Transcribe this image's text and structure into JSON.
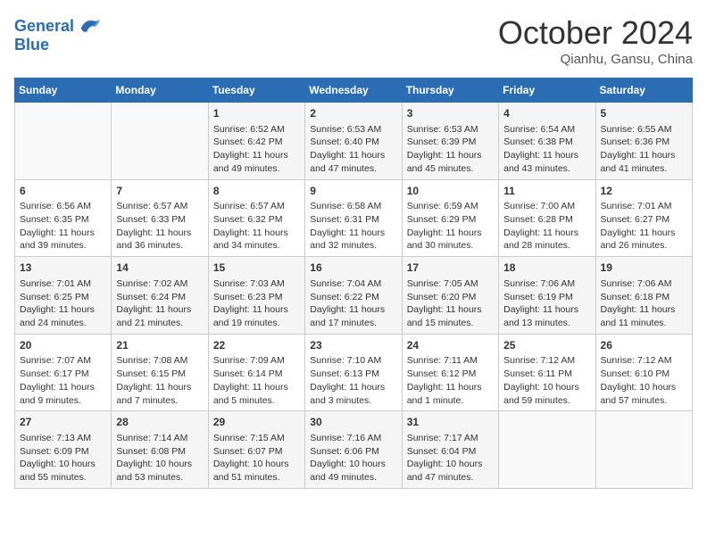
{
  "header": {
    "logo_line1": "General",
    "logo_line2": "Blue",
    "month": "October 2024",
    "location": "Qianhu, Gansu, China"
  },
  "weekdays": [
    "Sunday",
    "Monday",
    "Tuesday",
    "Wednesday",
    "Thursday",
    "Friday",
    "Saturday"
  ],
  "weeks": [
    [
      {
        "day": "",
        "sunrise": "",
        "sunset": "",
        "daylight": ""
      },
      {
        "day": "",
        "sunrise": "",
        "sunset": "",
        "daylight": ""
      },
      {
        "day": "1",
        "sunrise": "Sunrise: 6:52 AM",
        "sunset": "Sunset: 6:42 PM",
        "daylight": "Daylight: 11 hours and 49 minutes."
      },
      {
        "day": "2",
        "sunrise": "Sunrise: 6:53 AM",
        "sunset": "Sunset: 6:40 PM",
        "daylight": "Daylight: 11 hours and 47 minutes."
      },
      {
        "day": "3",
        "sunrise": "Sunrise: 6:53 AM",
        "sunset": "Sunset: 6:39 PM",
        "daylight": "Daylight: 11 hours and 45 minutes."
      },
      {
        "day": "4",
        "sunrise": "Sunrise: 6:54 AM",
        "sunset": "Sunset: 6:38 PM",
        "daylight": "Daylight: 11 hours and 43 minutes."
      },
      {
        "day": "5",
        "sunrise": "Sunrise: 6:55 AM",
        "sunset": "Sunset: 6:36 PM",
        "daylight": "Daylight: 11 hours and 41 minutes."
      }
    ],
    [
      {
        "day": "6",
        "sunrise": "Sunrise: 6:56 AM",
        "sunset": "Sunset: 6:35 PM",
        "daylight": "Daylight: 11 hours and 39 minutes."
      },
      {
        "day": "7",
        "sunrise": "Sunrise: 6:57 AM",
        "sunset": "Sunset: 6:33 PM",
        "daylight": "Daylight: 11 hours and 36 minutes."
      },
      {
        "day": "8",
        "sunrise": "Sunrise: 6:57 AM",
        "sunset": "Sunset: 6:32 PM",
        "daylight": "Daylight: 11 hours and 34 minutes."
      },
      {
        "day": "9",
        "sunrise": "Sunrise: 6:58 AM",
        "sunset": "Sunset: 6:31 PM",
        "daylight": "Daylight: 11 hours and 32 minutes."
      },
      {
        "day": "10",
        "sunrise": "Sunrise: 6:59 AM",
        "sunset": "Sunset: 6:29 PM",
        "daylight": "Daylight: 11 hours and 30 minutes."
      },
      {
        "day": "11",
        "sunrise": "Sunrise: 7:00 AM",
        "sunset": "Sunset: 6:28 PM",
        "daylight": "Daylight: 11 hours and 28 minutes."
      },
      {
        "day": "12",
        "sunrise": "Sunrise: 7:01 AM",
        "sunset": "Sunset: 6:27 PM",
        "daylight": "Daylight: 11 hours and 26 minutes."
      }
    ],
    [
      {
        "day": "13",
        "sunrise": "Sunrise: 7:01 AM",
        "sunset": "Sunset: 6:25 PM",
        "daylight": "Daylight: 11 hours and 24 minutes."
      },
      {
        "day": "14",
        "sunrise": "Sunrise: 7:02 AM",
        "sunset": "Sunset: 6:24 PM",
        "daylight": "Daylight: 11 hours and 21 minutes."
      },
      {
        "day": "15",
        "sunrise": "Sunrise: 7:03 AM",
        "sunset": "Sunset: 6:23 PM",
        "daylight": "Daylight: 11 hours and 19 minutes."
      },
      {
        "day": "16",
        "sunrise": "Sunrise: 7:04 AM",
        "sunset": "Sunset: 6:22 PM",
        "daylight": "Daylight: 11 hours and 17 minutes."
      },
      {
        "day": "17",
        "sunrise": "Sunrise: 7:05 AM",
        "sunset": "Sunset: 6:20 PM",
        "daylight": "Daylight: 11 hours and 15 minutes."
      },
      {
        "day": "18",
        "sunrise": "Sunrise: 7:06 AM",
        "sunset": "Sunset: 6:19 PM",
        "daylight": "Daylight: 11 hours and 13 minutes."
      },
      {
        "day": "19",
        "sunrise": "Sunrise: 7:06 AM",
        "sunset": "Sunset: 6:18 PM",
        "daylight": "Daylight: 11 hours and 11 minutes."
      }
    ],
    [
      {
        "day": "20",
        "sunrise": "Sunrise: 7:07 AM",
        "sunset": "Sunset: 6:17 PM",
        "daylight": "Daylight: 11 hours and 9 minutes."
      },
      {
        "day": "21",
        "sunrise": "Sunrise: 7:08 AM",
        "sunset": "Sunset: 6:15 PM",
        "daylight": "Daylight: 11 hours and 7 minutes."
      },
      {
        "day": "22",
        "sunrise": "Sunrise: 7:09 AM",
        "sunset": "Sunset: 6:14 PM",
        "daylight": "Daylight: 11 hours and 5 minutes."
      },
      {
        "day": "23",
        "sunrise": "Sunrise: 7:10 AM",
        "sunset": "Sunset: 6:13 PM",
        "daylight": "Daylight: 11 hours and 3 minutes."
      },
      {
        "day": "24",
        "sunrise": "Sunrise: 7:11 AM",
        "sunset": "Sunset: 6:12 PM",
        "daylight": "Daylight: 11 hours and 1 minute."
      },
      {
        "day": "25",
        "sunrise": "Sunrise: 7:12 AM",
        "sunset": "Sunset: 6:11 PM",
        "daylight": "Daylight: 10 hours and 59 minutes."
      },
      {
        "day": "26",
        "sunrise": "Sunrise: 7:12 AM",
        "sunset": "Sunset: 6:10 PM",
        "daylight": "Daylight: 10 hours and 57 minutes."
      }
    ],
    [
      {
        "day": "27",
        "sunrise": "Sunrise: 7:13 AM",
        "sunset": "Sunset: 6:09 PM",
        "daylight": "Daylight: 10 hours and 55 minutes."
      },
      {
        "day": "28",
        "sunrise": "Sunrise: 7:14 AM",
        "sunset": "Sunset: 6:08 PM",
        "daylight": "Daylight: 10 hours and 53 minutes."
      },
      {
        "day": "29",
        "sunrise": "Sunrise: 7:15 AM",
        "sunset": "Sunset: 6:07 PM",
        "daylight": "Daylight: 10 hours and 51 minutes."
      },
      {
        "day": "30",
        "sunrise": "Sunrise: 7:16 AM",
        "sunset": "Sunset: 6:06 PM",
        "daylight": "Daylight: 10 hours and 49 minutes."
      },
      {
        "day": "31",
        "sunrise": "Sunrise: 7:17 AM",
        "sunset": "Sunset: 6:04 PM",
        "daylight": "Daylight: 10 hours and 47 minutes."
      },
      {
        "day": "",
        "sunrise": "",
        "sunset": "",
        "daylight": ""
      },
      {
        "day": "",
        "sunrise": "",
        "sunset": "",
        "daylight": ""
      }
    ]
  ]
}
